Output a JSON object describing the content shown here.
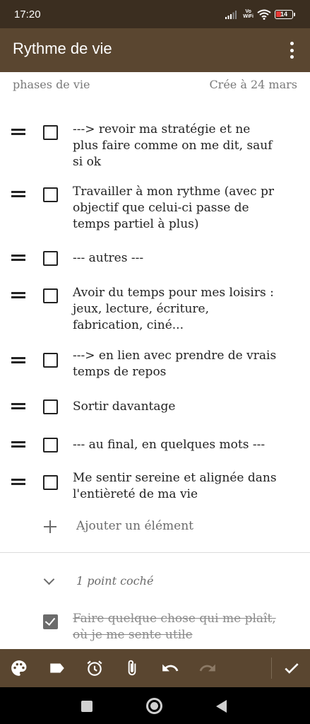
{
  "status": {
    "time": "17:20",
    "network": "Vo WiFi",
    "battery": "14",
    "battery_color": "#e53935"
  },
  "appbar": {
    "title": "Rythme de vie",
    "more_icon": "more-vert-icon",
    "background": "#5a4630"
  },
  "meta": {
    "label": "phases de vie",
    "created": "Crée à 24 mars"
  },
  "items": [
    {
      "text": "---> revoir ma stratégie et ne plus faire comme on me dit, sauf si ok"
    },
    {
      "text": "Travailler à mon rythme (avec pr objectif que celui-ci passe de temps partiel à plus)"
    },
    {
      "text": "--- autres ---"
    },
    {
      "text": "Avoir du temps pour mes loisirs : jeux, lecture, écriture, fabrication, ciné..."
    },
    {
      "text": "---> en lien avec prendre de vrais temps de repos"
    },
    {
      "text": "Sortir davantage"
    },
    {
      "text": "--- au final, en quelques mots ---"
    },
    {
      "text": "Me sentir sereine et alignée dans l'entièreté de ma vie"
    }
  ],
  "add_item": {
    "label": "Ajouter un élément"
  },
  "checked": {
    "header": "1 point coché",
    "items": [
      {
        "text": "Faire quelque chose qui me plaît, où je me sente utile"
      }
    ]
  },
  "toolbar": {
    "icons": [
      "palette-icon",
      "label-icon",
      "alarm-icon",
      "attach-icon",
      "undo-icon",
      "redo-icon",
      "done-check-icon"
    ],
    "background": "#5a4630"
  },
  "navbar": {
    "icons": [
      "recent-apps-icon",
      "home-icon",
      "back-icon"
    ]
  }
}
